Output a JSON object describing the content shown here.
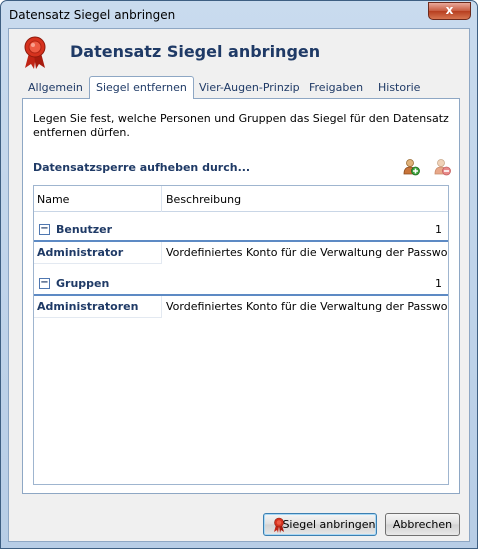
{
  "window": {
    "title": "Datensatz Siegel anbringen",
    "close_glyph": "x"
  },
  "header": {
    "title": "Datensatz Siegel anbringen",
    "icon": "seal-ribbon-icon"
  },
  "tabs": [
    {
      "label": "Allgemein",
      "active": false
    },
    {
      "label": "Siegel entfernen",
      "active": true
    },
    {
      "label": "Vier-Augen-Prinzip",
      "active": false
    },
    {
      "label": "Freigaben",
      "active": false
    },
    {
      "label": "Historie",
      "active": false
    }
  ],
  "panel": {
    "description": "Legen Sie fest, welche Personen und Gruppen das Siegel für den Datensatz entfernen dürfen.",
    "section_title": "Datensatzsperre aufheben durch...",
    "add_icon": "add-user-icon",
    "remove_icon": "remove-user-icon"
  },
  "grid": {
    "columns": [
      "Name",
      "Beschreibung"
    ],
    "groups": [
      {
        "label": "Benutzer",
        "count": "1",
        "expander": "−",
        "rows": [
          {
            "name": "Administrator",
            "description": "Vordefiniertes Konto für die Verwaltung der Passwortdatenbank"
          }
        ]
      },
      {
        "label": "Gruppen",
        "count": "1",
        "expander": "−",
        "rows": [
          {
            "name": "Administratoren",
            "description": "Vordefiniertes Konto für die Verwaltung der Passwortdatenbank"
          }
        ]
      }
    ]
  },
  "buttons": {
    "apply": "Siegel anbringen",
    "cancel": "Abbrechen"
  },
  "colors": {
    "accent": "#1f3a66",
    "seal_red": "#d6321e",
    "group_line": "#5d8ac4"
  }
}
